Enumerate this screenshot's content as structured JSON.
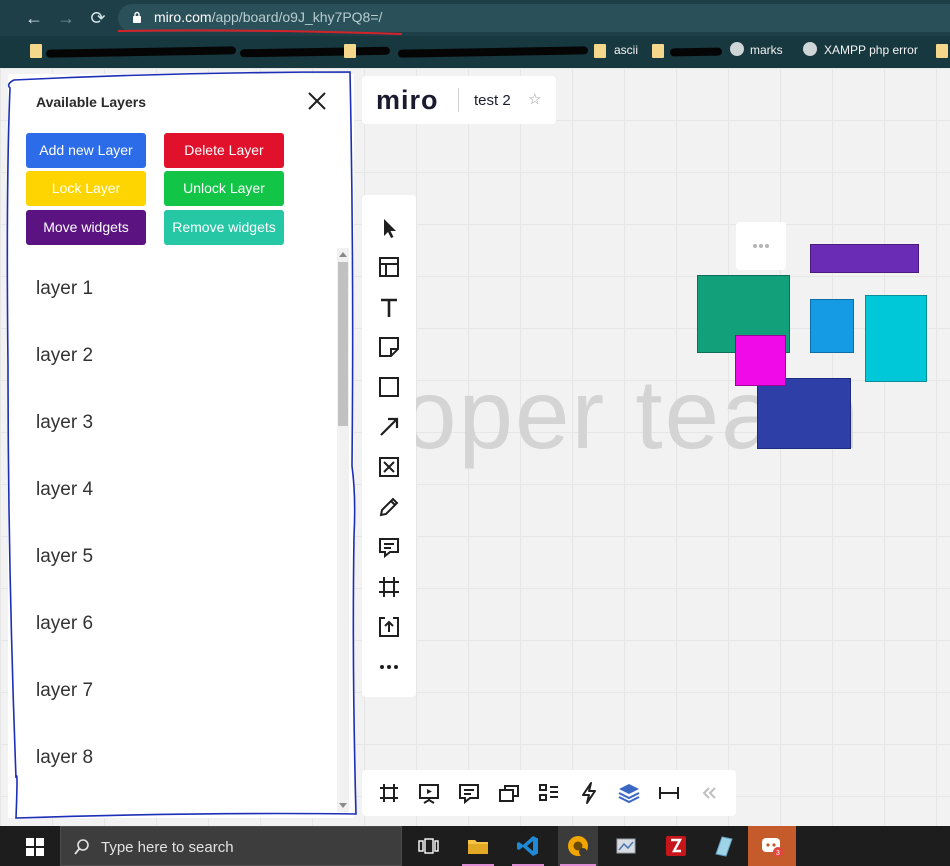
{
  "browser": {
    "url_host": "miro.com",
    "url_path": "/app/board/o9J_khy7PQ8=/",
    "bookmarks": [
      "ascii",
      "marks",
      "XAMPP php error"
    ]
  },
  "miro": {
    "logo": "miro",
    "board_name": "test 2",
    "watermark_text": "oper team"
  },
  "panel": {
    "title": "Available Layers",
    "buttons": {
      "add": "Add new Layer",
      "delete": "Delete Layer",
      "lock": "Lock Layer",
      "unlock": "Unlock Layer",
      "move": "Move widgets",
      "remove": "Remove widgets"
    },
    "layers": [
      "layer 1",
      "layer 2",
      "layer 3",
      "layer 4",
      "layer 5",
      "layer 6",
      "layer 7",
      "layer 8"
    ]
  },
  "toolbar": {
    "tools": [
      "select-icon",
      "templates-icon",
      "text-icon",
      "sticky-note-icon",
      "shape-icon",
      "arrow-icon",
      "image-frame-icon",
      "pen-icon",
      "comment-icon",
      "frame-icon",
      "upload-icon",
      "more-icon"
    ]
  },
  "bottombar": {
    "tools": [
      "frames-icon",
      "presentation-icon",
      "comments-icon",
      "cards-icon",
      "kanban-icon",
      "lightning-icon",
      "layers-icon",
      "ruler-icon",
      "collapse-icon"
    ]
  },
  "colors": {
    "add": "#2d6ce8",
    "delete": "#e2112b",
    "lock": "#ffd500",
    "unlock": "#12c547",
    "move": "#5a1381",
    "remove": "#25c7a5",
    "widget_teal": "#12a07a",
    "widget_purple": "#6a2cb4",
    "widget_blue": "#149be4",
    "widget_cyan": "#00c8d8",
    "widget_magenta": "#f00ae8",
    "widget_indigo": "#2e3fa8"
  },
  "taskbar": {
    "search_placeholder": "Type here to search",
    "badge": "3"
  }
}
